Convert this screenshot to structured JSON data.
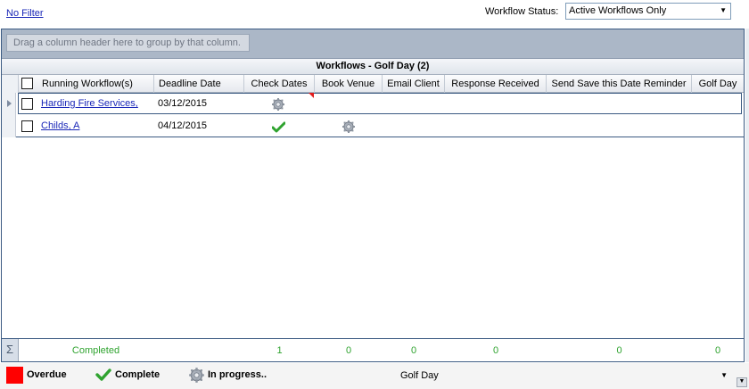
{
  "topbar": {
    "no_filter": "No Filter",
    "workflow_status_label": "Workflow Status:",
    "workflow_status_value": "Active Workflows Only"
  },
  "grid": {
    "group_hint": "Drag a column header here to group by that column.",
    "band_title": "Workflows - Golf Day (2)",
    "columns": [
      "Running Workflow(s)",
      "Deadline Date",
      "Check Dates",
      "Book Venue",
      "Email Client",
      "Response Received",
      "Send Save this Date Reminder",
      "Golf Day"
    ],
    "rows": [
      {
        "name": "Harding Fire Services,",
        "deadline": "03/12/2015",
        "check_dates": "in-progress",
        "book_venue": "",
        "overdue_flag": true,
        "selected": true
      },
      {
        "name": "Childs, A",
        "deadline": "04/12/2015",
        "check_dates": "complete",
        "book_venue": "in-progress",
        "overdue_flag": false,
        "selected": false
      }
    ],
    "summary": {
      "label": "Completed",
      "check_dates": "1",
      "book_venue": "0",
      "email_client": "0",
      "response_received": "0",
      "send_reminder": "0",
      "golf_day": "0"
    }
  },
  "legend": {
    "overdue": "Overdue",
    "complete": "Complete",
    "in_progress": "In progress..",
    "workflow_select": "Golf Day"
  },
  "colors": {
    "overdue": "#ff0000",
    "complete": "#2fa32f",
    "link": "#1a27b8",
    "frame": "#3b5a82"
  }
}
